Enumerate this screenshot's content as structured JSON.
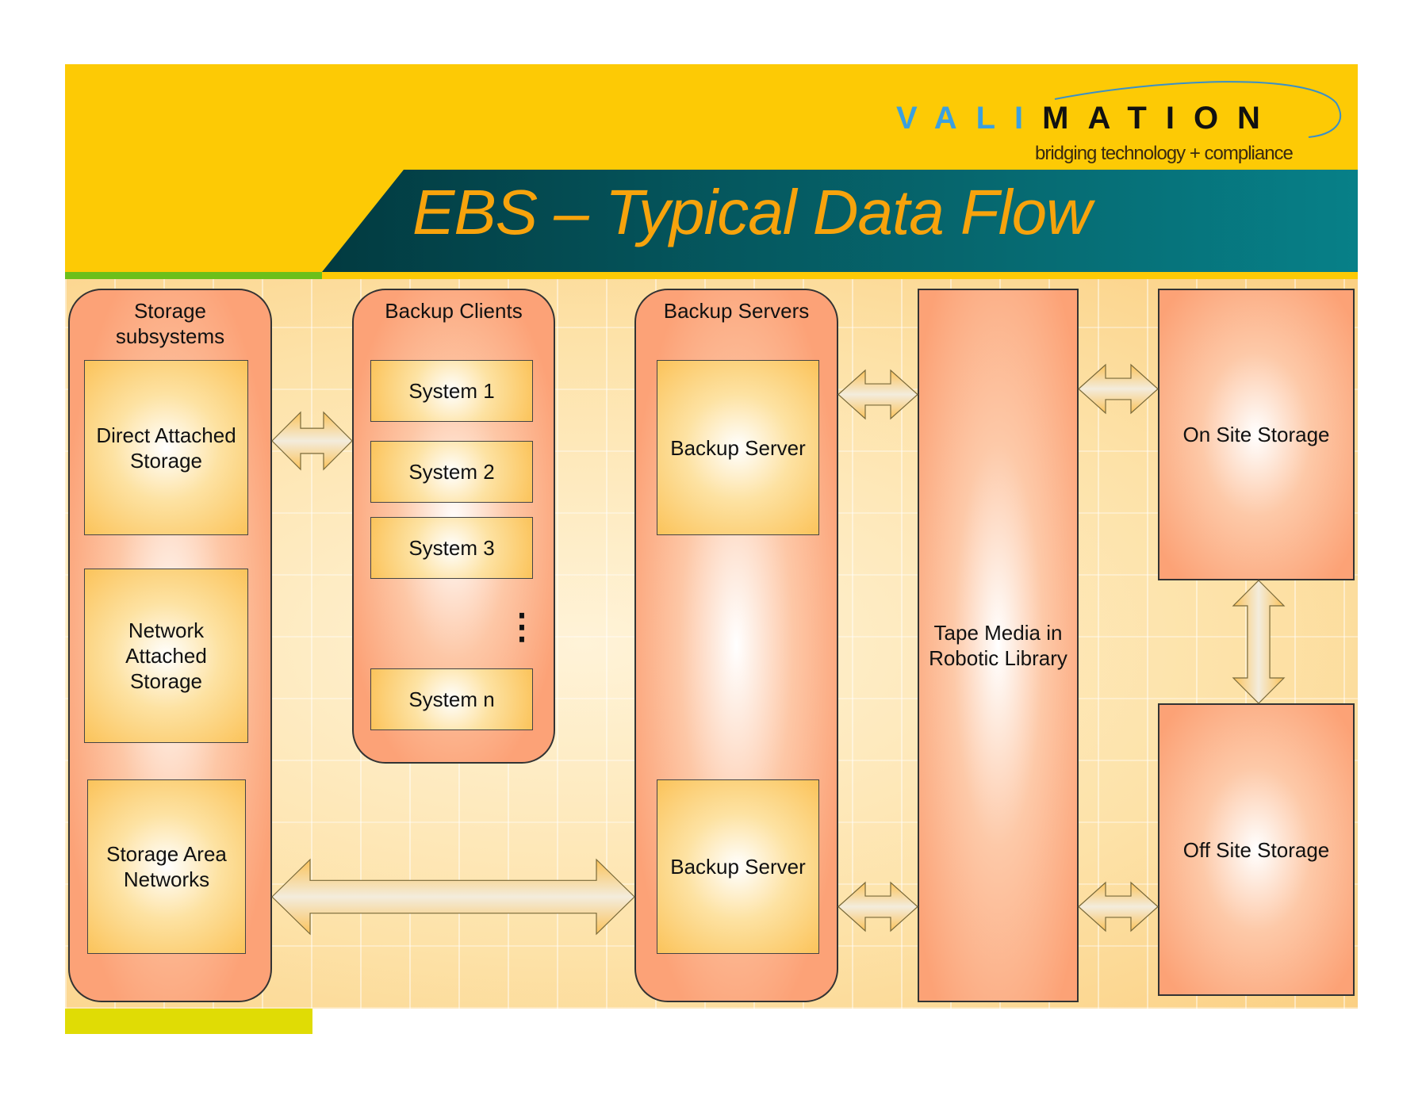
{
  "header": {
    "title": "EBS – Typical Data Flow",
    "logo_blue": "VALI",
    "logo_black": "MATION",
    "tagline": "bridging technology + compliance"
  },
  "columns": {
    "storage": {
      "title": "Storage subsystems",
      "items": [
        "Direct Attached Storage",
        "Network Attached Storage",
        "Storage Area Networks"
      ]
    },
    "clients": {
      "title": "Backup Clients",
      "items": [
        "System 1",
        "System 2",
        "System 3",
        "System n"
      ],
      "ellipsis": "⋮"
    },
    "servers": {
      "title": "Backup Servers",
      "items": [
        "Backup Server",
        "Backup Server"
      ]
    },
    "tape": "Tape Media in Robotic Library",
    "onsite": "On Site Storage",
    "offsite": "Off Site Storage"
  },
  "colors": {
    "header_yellow": "#fdca05",
    "banner_teal": "#05585f",
    "title_orange": "#f7a30c",
    "pill": "#fca277",
    "box": "#fbc35a"
  }
}
